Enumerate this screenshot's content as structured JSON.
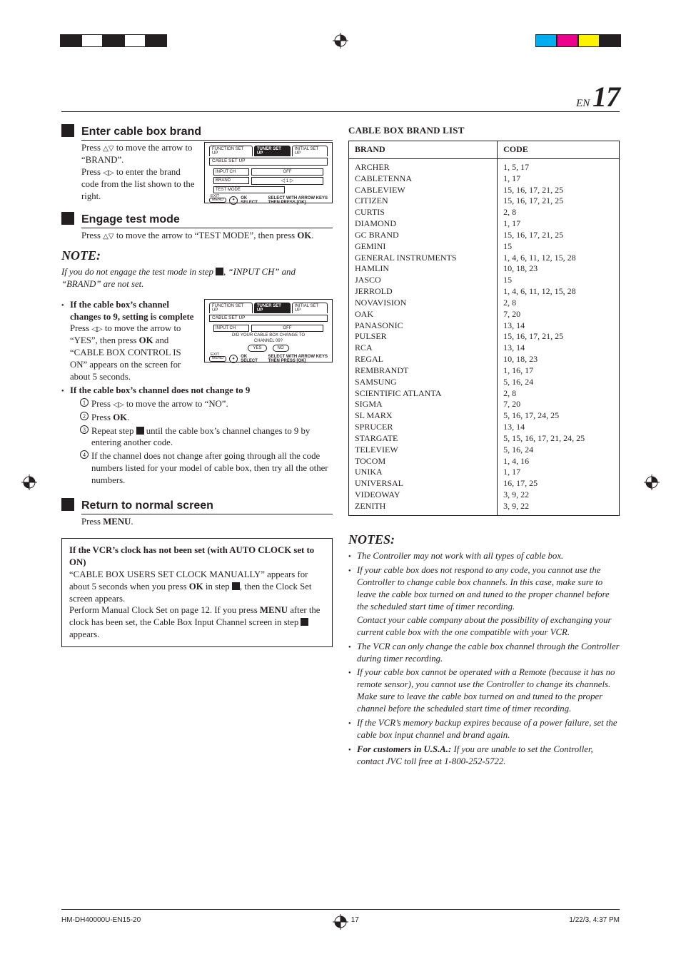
{
  "page": {
    "prefix": "EN",
    "number": "17"
  },
  "left": {
    "step7": {
      "title": "Enter cable box brand",
      "p1a": "Press ",
      "p1b": " to move the arrow to “BRAND”.",
      "p2a": "Press ",
      "p2b": " to enter the brand code from the list shown to the right.",
      "osd": {
        "tab1": "FUNCTION SET UP",
        "tab2": "TUNER SET UP",
        "tab3": "INITIAL SET UP",
        "panel": "CABLE SET UP",
        "row1_label": "INPUT CH",
        "row1_value": "OFF",
        "row2_label": "BRAND",
        "row2_value": "1",
        "row3_label": "TEST MODE",
        "guide_menu": "MENU",
        "guide_exit": "EXIT",
        "guide_ok": "OK",
        "guide_select": "SELECT",
        "guide_right1": "SELECT WITH ARROW KEYS",
        "guide_right2": "THEN PRESS [OK]"
      }
    },
    "step8": {
      "title": "Engage test mode",
      "p1a": "Press ",
      "p1b": " to move the arrow to “TEST MODE”, then press ",
      "p1c": "OK",
      "p1d": "."
    },
    "note": {
      "heading": "NOTE:",
      "body_a": "If you do not engage the test mode in step ",
      "body_b": ", “INPUT CH” and “BRAND” are not set."
    },
    "caseA": {
      "title": "If the cable box’s channel changes to 9, setting is complete",
      "p1a": "Press ",
      "p1b": " to move the arrow to “YES”,  then press ",
      "p1c": "OK",
      "p1d": " and “CABLE BOX CONTROL IS ON” appears on the screen for about 5 seconds.",
      "osd": {
        "tab1": "FUNCTION SET UP",
        "tab2": "TUNER SET UP",
        "tab3": "INITIAL SET UP",
        "panel": "CABLE SET UP",
        "row1_label": "INPUT CH",
        "row1_value": "OFF",
        "msg1": "DID YOUR CABLE BOX CHANGE TO",
        "msg2": "CHANNEL 09?",
        "yes": "YES",
        "no": "NO",
        "guide_menu": "MENU",
        "guide_exit": "EXIT",
        "guide_ok": "OK",
        "guide_select": "SELECT",
        "guide_right1": "SELECT WITH ARROW KEYS",
        "guide_right2": "THEN PRESS [OK]"
      }
    },
    "caseB": {
      "title": "If the cable box’s channel does not change to 9",
      "s1a": "Press ",
      "s1b": " to move the arrow to “NO”.",
      "s2a": "Press ",
      "s2b": "OK",
      "s2c": ".",
      "s3a": "Repeat step ",
      "s3b": " until the cable box’s channel changes to 9 by entering another code.",
      "s4": "If the channel does not change after going through all the code numbers listed for your model of cable box, then try all the other numbers."
    },
    "step9": {
      "title": "Return to normal screen",
      "p1a": "Press ",
      "p1b": "MENU",
      "p1c": "."
    },
    "boxed": {
      "title": "If the VCR’s clock has not been set (with AUTO CLOCK set to ON)",
      "p1a": "“CABLE BOX USERS SET CLOCK MANUALLY” appears for about 5 seconds when you press ",
      "p1b": "OK",
      "p1c": " in step ",
      "p1d": ", then the Clock Set screen appears.",
      "p2a": "Perform Manual Clock Set on page 12. If you press ",
      "p2b": "MENU",
      "p2c": " after the clock has been set, the Cable Box Input Channel screen in step ",
      "p2d": " appears."
    }
  },
  "right": {
    "list_title": "CABLE BOX BRAND LIST",
    "th_brand": "BRAND",
    "th_code": "CODE",
    "brands": [
      {
        "name": "ARCHER",
        "codes": "1, 5, 17"
      },
      {
        "name": "CABLETENNA",
        "codes": "1, 17"
      },
      {
        "name": "CABLEVIEW",
        "codes": "15, 16, 17, 21, 25"
      },
      {
        "name": "CITIZEN",
        "codes": "15, 16, 17, 21, 25"
      },
      {
        "name": "CURTIS",
        "codes": "2, 8"
      },
      {
        "name": "DIAMOND",
        "codes": "1, 17"
      },
      {
        "name": "GC BRAND",
        "codes": "15, 16, 17, 21, 25"
      },
      {
        "name": "GEMINI",
        "codes": "15"
      },
      {
        "name": "GENERAL INSTRUMENTS",
        "codes": "1, 4, 6, 11, 12, 15, 28"
      },
      {
        "name": "HAMLIN",
        "codes": "10, 18, 23"
      },
      {
        "name": "JASCO",
        "codes": "15"
      },
      {
        "name": "JERROLD",
        "codes": "1, 4, 6, 11, 12, 15, 28"
      },
      {
        "name": "NOVAVISION",
        "codes": "2, 8"
      },
      {
        "name": "OAK",
        "codes": "7, 20"
      },
      {
        "name": "PANASONIC",
        "codes": "13, 14"
      },
      {
        "name": "PULSER",
        "codes": "15, 16, 17, 21, 25"
      },
      {
        "name": "RCA",
        "codes": "13, 14"
      },
      {
        "name": "REGAL",
        "codes": "10, 18, 23"
      },
      {
        "name": "REMBRANDT",
        "codes": "1, 16, 17"
      },
      {
        "name": "SAMSUNG",
        "codes": "5, 16, 24"
      },
      {
        "name": "SCIENTIFIC ATLANTA",
        "codes": "2, 8"
      },
      {
        "name": "SIGMA",
        "codes": "7, 20"
      },
      {
        "name": "SL MARX",
        "codes": "5, 16, 17, 24, 25"
      },
      {
        "name": "SPRUCER",
        "codes": "13, 14"
      },
      {
        "name": "STARGATE",
        "codes": "5, 15, 16, 17, 21, 24, 25"
      },
      {
        "name": "TELEVIEW",
        "codes": "5, 16, 24"
      },
      {
        "name": "TOCOM",
        "codes": "1, 4, 16"
      },
      {
        "name": "UNIKA",
        "codes": "1, 17"
      },
      {
        "name": "UNIVERSAL",
        "codes": "16, 17, 25"
      },
      {
        "name": "VIDEOWAY",
        "codes": "3, 9, 22"
      },
      {
        "name": "ZENITH",
        "codes": "3, 9, 22"
      }
    ],
    "notes_heading": "NOTES:",
    "notes": [
      {
        "t": "The Controller may not work with all types of cable box."
      },
      {
        "t": "If your cable box does not respond to any code, you cannot use the Controller to change cable box channels. In this case, make sure to leave the cable box turned on and tuned to the proper channel before the scheduled start time of timer recording.",
        "cont": "Contact your cable company about the possibility of exchanging your current cable box with the one compatible with your VCR."
      },
      {
        "t": "The VCR can only change the cable box channel through the Controller during timer recording."
      },
      {
        "t": "If your cable box cannot be operated with a Remote (because it has no remote sensor), you cannot use the Controller to change its channels. Make sure to leave the cable box turned on and tuned to the proper channel before the scheduled start time of timer recording."
      },
      {
        "t": "If the VCR’s memory backup expires because of a power failure, set the cable box input channel and brand again."
      },
      {
        "lead": "For customers in U.S.A.:",
        "t": " If you are unable to set the Controller, contact JVC toll free at 1-800-252-5722."
      }
    ]
  },
  "footer": {
    "left": "HM-DH40000U-EN15-20",
    "center": "17",
    "right": "1/22/3, 4:37 PM"
  }
}
